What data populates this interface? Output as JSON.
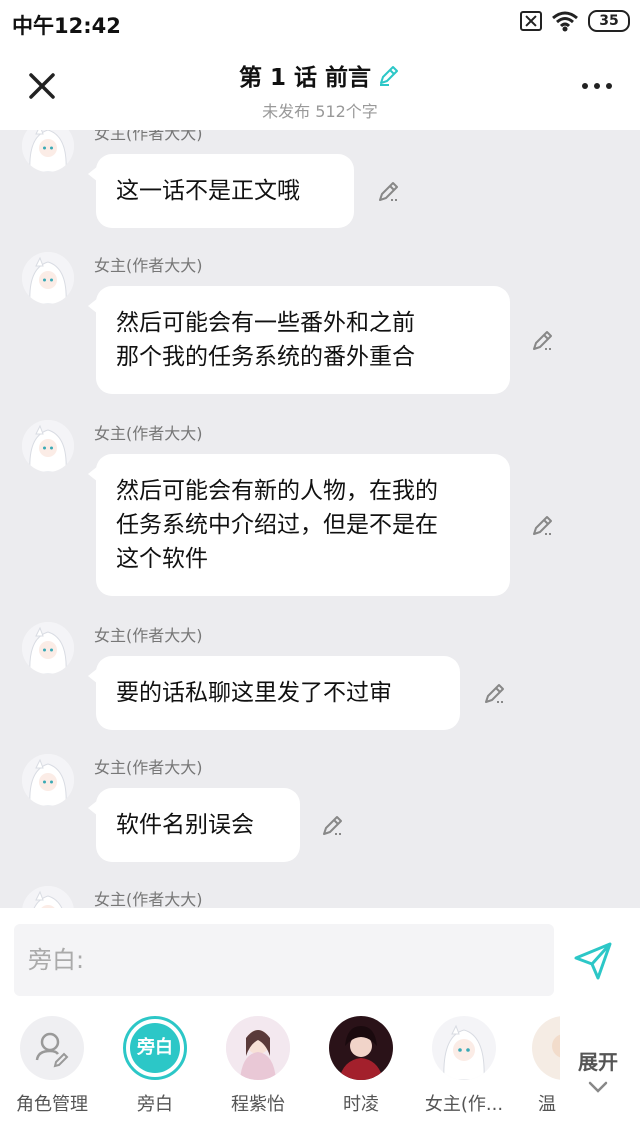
{
  "status": {
    "time": "中午12:42",
    "battery": "35"
  },
  "header": {
    "title": "第 1 话 前言",
    "subtitle": "未发布 512个字"
  },
  "messages": [
    {
      "sender": "女主(作者大大)",
      "lines": [
        "这一话不是正文哦"
      ]
    },
    {
      "sender": "女主(作者大大)",
      "lines": [
        "然后可能会有一些番外和之前",
        "那个我的任务系统的番外重合"
      ]
    },
    {
      "sender": "女主(作者大大)",
      "lines": [
        "然后可能会有新的人物，在我的",
        "任务系统中介绍过，但是不是在",
        "这个软件"
      ]
    },
    {
      "sender": "女主(作者大大)",
      "lines": [
        "要的话私聊这里发了不过审"
      ]
    },
    {
      "sender": "女主(作者大大)",
      "lines": [
        "软件名别误会"
      ]
    },
    {
      "sender": "女主(作者大大)",
      "lines": []
    }
  ],
  "composer": {
    "placeholder": "旁白:"
  },
  "roles": [
    {
      "label": "角色管理",
      "icon": "person-edit-icon"
    },
    {
      "label": "旁白",
      "badge": "旁白"
    },
    {
      "label": "程紫怡"
    },
    {
      "label": "时凌"
    },
    {
      "label": "女主(作..."
    },
    {
      "label": "温"
    }
  ],
  "expand_label": "展开",
  "colors": {
    "accent": "#2cc7c7",
    "chat_bg": "#ececef"
  }
}
